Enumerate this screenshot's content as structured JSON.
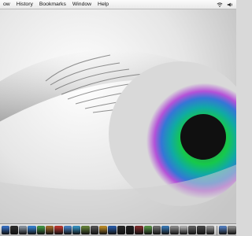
{
  "menubar": {
    "items": [
      "ow",
      "History",
      "Bookmarks",
      "Window",
      "Help"
    ],
    "status_icons": [
      "wifi-icon",
      "volume-icon"
    ]
  },
  "wallpaper": {
    "subject": "eye-close-up",
    "colors": {
      "iris_green": "#16c94a",
      "iris_teal": "#10a9a6",
      "iris_blue": "#3477d6",
      "iris_purple": "#b452d8",
      "pupil": "#101010",
      "skin_gray": "#d3d3d3"
    }
  },
  "dock": {
    "icons": [
      {
        "name": "finder-icon",
        "color": "#3a7ad8"
      },
      {
        "name": "dashboard-icon",
        "color": "#2f2f2f"
      },
      {
        "name": "mail-icon",
        "color": "#9aa6b3"
      },
      {
        "name": "safari-icon",
        "color": "#3a8ee6"
      },
      {
        "name": "ichat-icon",
        "color": "#49a64a"
      },
      {
        "name": "address-book-icon",
        "color": "#b3752f"
      },
      {
        "name": "ical-icon",
        "color": "#d23b32"
      },
      {
        "name": "preview-icon",
        "color": "#4f8fd8"
      },
      {
        "name": "itunes-icon",
        "color": "#3aa2d7"
      },
      {
        "name": "iphoto-icon",
        "color": "#6f8f3d"
      },
      {
        "name": "imovie-icon",
        "color": "#5b5b5b"
      },
      {
        "name": "garageband-icon",
        "color": "#d29b2b"
      },
      {
        "name": "iweb-icon",
        "color": "#2a62b7"
      },
      {
        "name": "idvd-icon",
        "color": "#2a2a2a"
      },
      {
        "name": "terminal-icon",
        "color": "#202020"
      },
      {
        "name": "photo-booth-icon",
        "color": "#8a2f2f"
      },
      {
        "name": "activity-monitor-icon",
        "color": "#5fa14a"
      },
      {
        "name": "system-preferences-icon",
        "color": "#7b7b7b"
      },
      {
        "name": "network-icon",
        "color": "#3c83c7"
      },
      {
        "name": "disk-icon",
        "color": "#9b9b9b"
      },
      {
        "name": "widget-icon",
        "color": "#c4c4c4"
      },
      {
        "name": "camera-icon",
        "color": "#6a6a6a"
      },
      {
        "name": "calculator-icon",
        "color": "#4c4c4c"
      },
      {
        "name": "printer-icon",
        "color": "#a0a0a0"
      },
      {
        "name": "folder-icon",
        "color": "#5a8bd4"
      },
      {
        "name": "trash-icon",
        "color": "#9c9c9c"
      }
    ]
  }
}
